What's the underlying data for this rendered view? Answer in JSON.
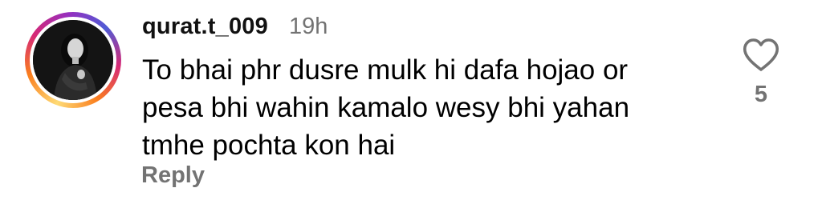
{
  "comment": {
    "username": "qurat.t_009",
    "timestamp": "19h",
    "text": "To bhai phr dusre mulk hi dafa hojao or\npesa bhi wahin kamalo wesy bhi yahan\ntmhe pochta kon hai",
    "reply_label": "Reply",
    "like_count": "5",
    "like_icon": "heart-outline-icon",
    "avatar_has_story_ring": true
  },
  "colors": {
    "secondary_text": "#737373",
    "primary_text": "#000000",
    "ring_gradient": [
      "#feda75",
      "#fa7e1e",
      "#d62976",
      "#962fbf",
      "#4f5bd5"
    ]
  }
}
